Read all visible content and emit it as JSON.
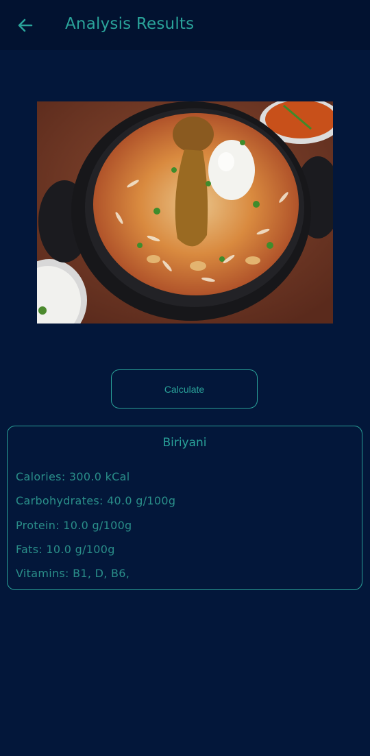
{
  "header": {
    "title": "Analysis Results",
    "back_icon": "arrow-left-icon"
  },
  "image": {
    "subject": "biriyani-dish-photo"
  },
  "actions": {
    "calculate_label": "Calculate"
  },
  "result": {
    "food_name": "Biriyani",
    "calories": "Calories: 300.0 kCal",
    "carbohydrates": "Carbohydrates: 40.0 g/100g",
    "protein": "Protein: 10.0 g/100g",
    "fats": "Fats: 10.0 g/100g",
    "vitamins": "Vitamins: B1, D, B6,"
  },
  "colors": {
    "background": "#03173a",
    "appbar": "#021230",
    "accent": "#2aa39a"
  }
}
